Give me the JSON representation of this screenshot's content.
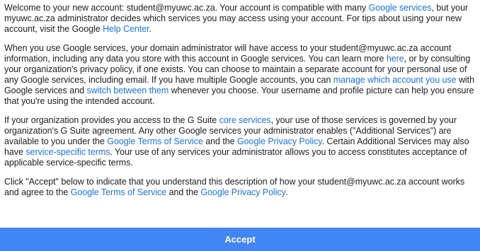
{
  "paragraph1": {
    "t1": "Welcome to your new account: student@myuwc.ac.za. Your account is compatible with many ",
    "link_google_services": "Google services",
    "t2": ", but your myuwc.ac.za administrator decides which services you may access using your account. For tips about using your new account, visit the Google ",
    "link_help_center": "Help Center",
    "t3": "."
  },
  "paragraph2": {
    "t1": "When you use Google services, your domain administrator will have access to your student@myuwc.ac.za account information, including any data you store with this account in Google services. You can learn more ",
    "link_here": "here",
    "t2": ", or by consulting your organization's privacy policy, if one exists. You can choose to maintain a separate account for your personal use of any Google services, including email. If you have multiple Google accounts, you can ",
    "link_manage_accounts": "manage which account you use",
    "t3": " with Google services and ",
    "link_switch": "switch between them",
    "t4": " whenever you choose. Your username and profile picture can help you ensure that you're using the intended account."
  },
  "paragraph3": {
    "t1": "If your organization provides you access to the G Suite ",
    "link_core_services": "core services",
    "t2": ", your use of those services is governed by your organization's G Suite agreement. Any other Google services your administrator enables (\"Additional Services\") are available to you under the ",
    "link_terms": "Google Terms of Service",
    "t3": " and the ",
    "link_privacy": "Google Privacy Policy",
    "t4": ". Certain Additional Services may also have ",
    "link_service_terms": "service-specific terms",
    "t5": ". Your use of any services your administrator allows you to access constitutes acceptance of applicable service-specific terms."
  },
  "paragraph4": {
    "t1": "Click \"Accept\" below to indicate that you understand this description of how your student@myuwc.ac.za account works and agree to the ",
    "link_terms": "Google Terms of Service",
    "t2": " and the ",
    "link_privacy": "Google Privacy Policy",
    "t3": "."
  },
  "accept_button": {
    "label": "Accept"
  },
  "colors": {
    "link": "#1a73e8",
    "button": "#4285f4",
    "text": "#202124"
  }
}
